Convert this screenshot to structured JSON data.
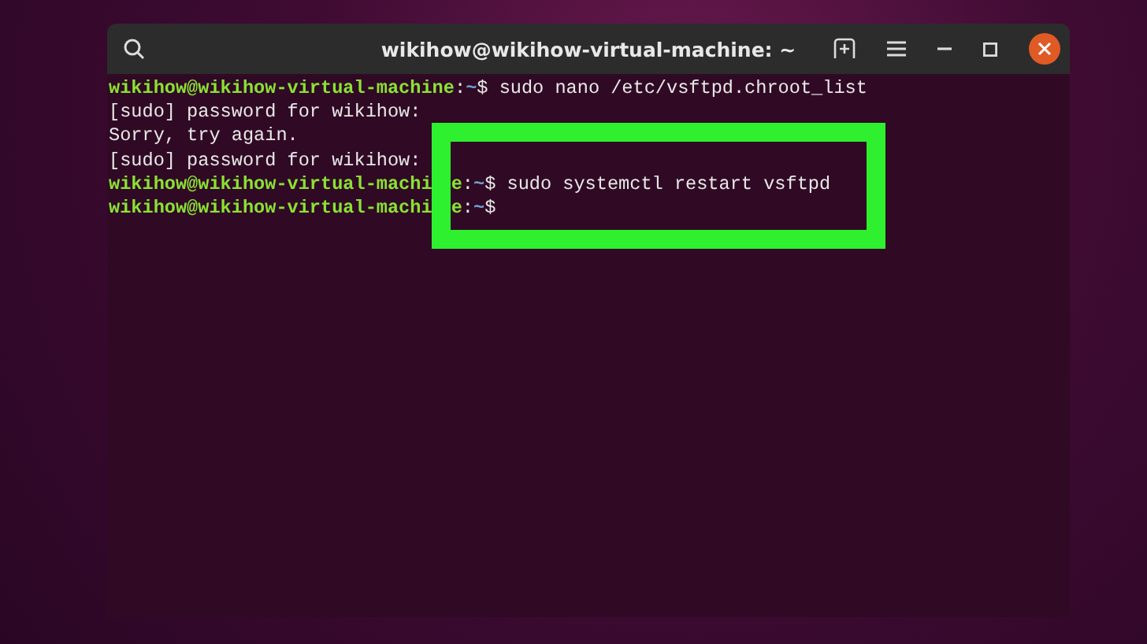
{
  "window": {
    "title": "wikihow@wikihow-virtual-machine: ~"
  },
  "terminal": {
    "lines": [
      {
        "segments": [
          {
            "kind": "prompt",
            "text": "wikihow@wikihow-virtual-machine"
          },
          {
            "kind": "text",
            "text": ":"
          },
          {
            "kind": "path",
            "text": "~"
          },
          {
            "kind": "text",
            "text": "$ sudo nano /etc/vsftpd.chroot_list"
          }
        ]
      },
      {
        "segments": [
          {
            "kind": "text",
            "text": "[sudo] password for wikihow:"
          }
        ]
      },
      {
        "segments": [
          {
            "kind": "text",
            "text": "Sorry, try again."
          }
        ]
      },
      {
        "segments": [
          {
            "kind": "text",
            "text": "[sudo] password for wikihow:"
          }
        ]
      },
      {
        "segments": [
          {
            "kind": "prompt",
            "text": "wikihow@wikihow-virtual-machi"
          },
          {
            "kind": "prompt",
            "text": "e",
            "after_gap": true
          },
          {
            "kind": "text",
            "text": ":"
          },
          {
            "kind": "path",
            "text": "~"
          },
          {
            "kind": "text",
            "text": "$ sudo systemctl restart vsftpd"
          }
        ]
      },
      {
        "segments": [
          {
            "kind": "prompt",
            "text": "wikihow@wikihow-virtual-machi"
          },
          {
            "kind": "prompt",
            "text": "e",
            "after_gap": true
          },
          {
            "kind": "text",
            "text": ":"
          },
          {
            "kind": "path",
            "text": "~"
          },
          {
            "kind": "text",
            "text": "$"
          }
        ]
      }
    ]
  },
  "highlight": {
    "color": "#2ef02e"
  }
}
